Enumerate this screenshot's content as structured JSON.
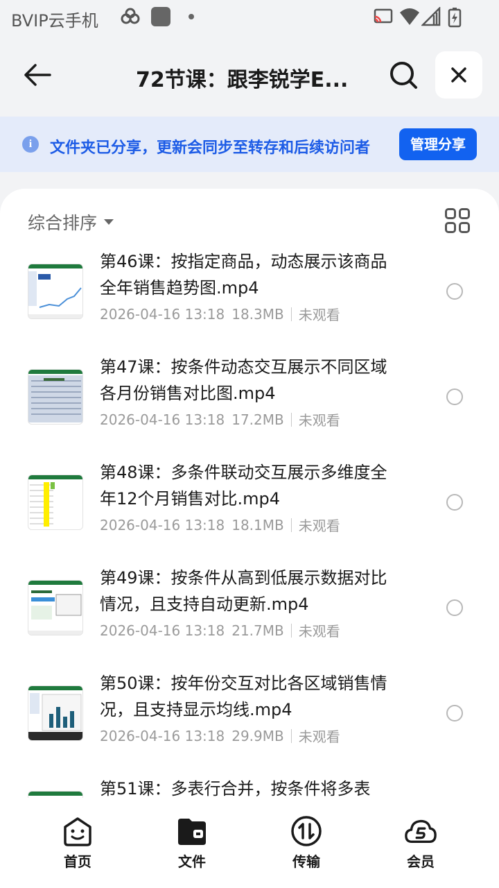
{
  "status_bar": {
    "carrier": "BVIP云手机"
  },
  "header": {
    "title": "72节课：跟李锐学E...",
    "back_icon": "arrow-left-icon",
    "search_icon": "search-icon",
    "close_icon": "close-icon"
  },
  "banner": {
    "message": "文件夹已分享，更新会同步至转存和后续访问者",
    "button": "管理分享",
    "accent": "#1262f0"
  },
  "sort": {
    "label": "综合排序"
  },
  "files": [
    {
      "name": "第46课：按指定商品，动态展示该商品全年销售趋势图.mp4",
      "date": "2026-04-16 13:18",
      "size": "18.3MB",
      "status": "未观看"
    },
    {
      "name": "第47课：按条件动态交互展示不同区域各月份销售对比图.mp4",
      "date": "2026-04-16 13:18",
      "size": "17.2MB",
      "status": "未观看"
    },
    {
      "name": "第48课：多条件联动交互展示多维度全年12个月销售对比.mp4",
      "date": "2026-04-16 13:18",
      "size": "18.1MB",
      "status": "未观看"
    },
    {
      "name": "第49课：按条件从高到低展示数据对比情况，且支持自动更新.mp4",
      "date": "2026-04-16 13:18",
      "size": "21.7MB",
      "status": "未观看"
    },
    {
      "name": "第50课：按年份交互对比各区域销售情况，且支持显示均线.mp4",
      "date": "2026-04-16 13:18",
      "size": "29.9MB",
      "status": "未观看"
    },
    {
      "name": "第51课：多表行合并，按条件将多表",
      "date": "",
      "size": "",
      "status": ""
    }
  ],
  "tabs": [
    {
      "label": "首页",
      "icon": "home-smile-icon"
    },
    {
      "label": "文件",
      "icon": "folder-icon"
    },
    {
      "label": "传输",
      "icon": "transfer-icon"
    },
    {
      "label": "会员",
      "icon": "vip-cloud-icon"
    }
  ]
}
